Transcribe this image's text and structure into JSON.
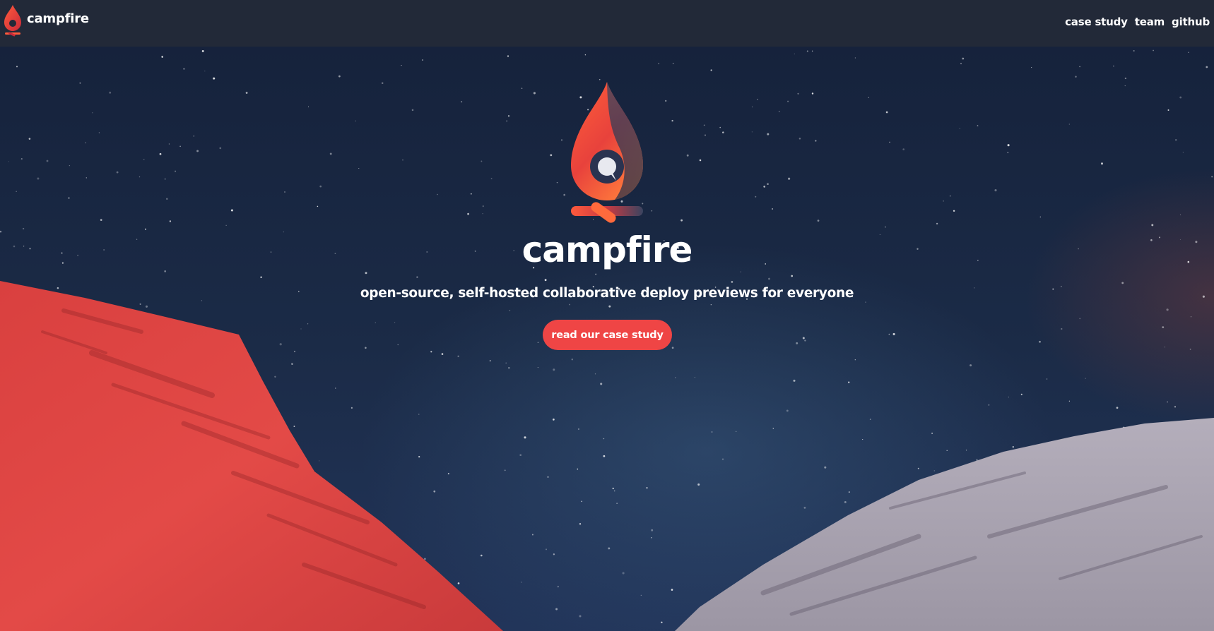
{
  "header": {
    "brand_name": "campfire",
    "nav": {
      "case_study": "case study",
      "team": "team",
      "github": "github"
    }
  },
  "hero": {
    "title": "campfire",
    "tagline": "open-source, self-hosted collaborative deploy previews for everyone",
    "cta_label": "read our case study"
  },
  "colors": {
    "header_bg": "#222938",
    "accent": "#ef4545",
    "sky": "#1b2b47",
    "mountain_left": "#e04848",
    "mountain_right": "#a7a1ad"
  },
  "icons": {
    "brand": "campfire-flame-icon",
    "hero": "campfire-flame-logo"
  }
}
